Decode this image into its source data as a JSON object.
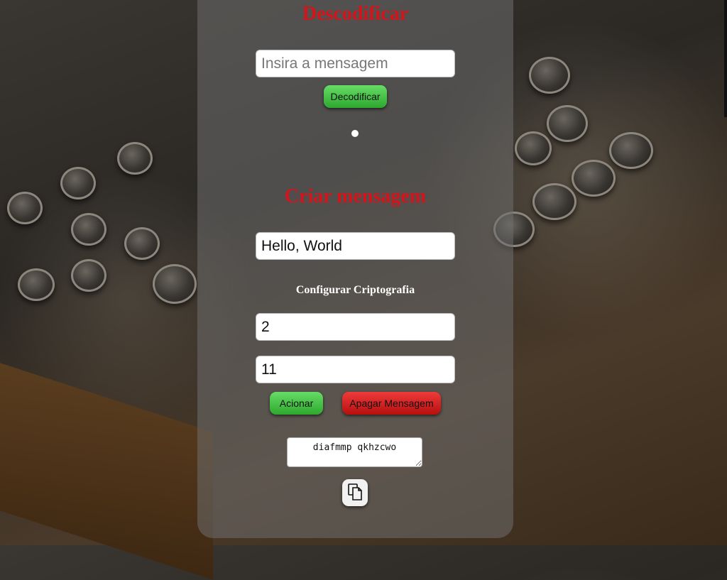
{
  "decode": {
    "title": "Descodificar",
    "input_placeholder": "Insira a mensagem",
    "input_value": "",
    "button_label": "Decodificar"
  },
  "create": {
    "title": "Criar mensagem",
    "message_value": "Hello, World",
    "config_title": "Configurar Criptografia",
    "key1_value": "2",
    "key2_value": "11",
    "add_label": "Acionar",
    "clear_label": "Apagar Mensagem",
    "output_value": "diafmmp qkhzcwo"
  },
  "icons": {
    "copy": "copy-icon"
  },
  "colors": {
    "heading": "#d4141a",
    "green_button": "#3fbf3f",
    "red_button": "#d42222"
  }
}
